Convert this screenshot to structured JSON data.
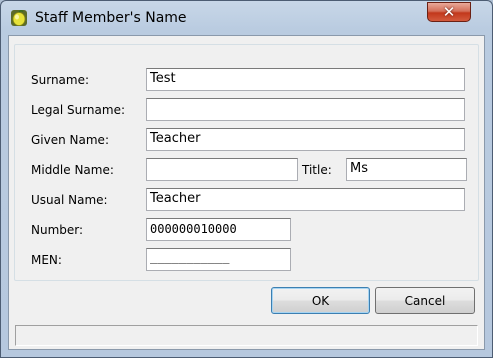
{
  "window": {
    "title": "Staff Member's Name",
    "app_icon": "lemon-app-icon",
    "close_icon": "close-icon",
    "close_glyph": "✕"
  },
  "form": {
    "surname": {
      "label": "Surname:",
      "value": "Test"
    },
    "legal_surname": {
      "label": "Legal Surname:",
      "value": ""
    },
    "given_name": {
      "label": "Given Name:",
      "value": "Teacher"
    },
    "middle_name": {
      "label": "Middle Name:",
      "value": ""
    },
    "title": {
      "label": "Title:",
      "value": "Ms"
    },
    "usual_name": {
      "label": "Usual Name:",
      "value": "Teacher"
    },
    "number": {
      "label": "Number:",
      "value": "000000010000"
    },
    "men": {
      "label": "MEN:",
      "value": "___________"
    }
  },
  "buttons": {
    "ok": "OK",
    "cancel": "Cancel"
  },
  "status": {
    "text": ""
  }
}
